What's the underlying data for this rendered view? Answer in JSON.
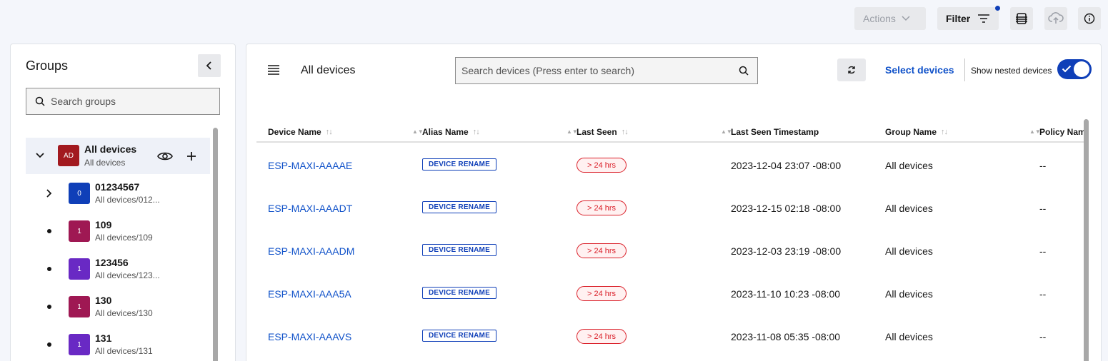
{
  "topbar": {
    "actions_label": "Actions",
    "filter_label": "Filter"
  },
  "groups": {
    "title": "Groups",
    "search_placeholder": "Search groups",
    "items": [
      {
        "initials": "AD",
        "name": "All devices",
        "path": "All devices",
        "color": "#a2191f"
      },
      {
        "initials": "0",
        "name": "01234567",
        "path": "All devices/012...",
        "color": "#0f3fb8"
      },
      {
        "initials": "1",
        "name": "109",
        "path": "All devices/109",
        "color": "#9f1853"
      },
      {
        "initials": "1",
        "name": "123456",
        "path": "All devices/123...",
        "color": "#6929c4"
      },
      {
        "initials": "1",
        "name": "130",
        "path": "All devices/130",
        "color": "#9f1853"
      },
      {
        "initials": "1",
        "name": "131",
        "path": "All devices/131",
        "color": "#6929c4"
      }
    ]
  },
  "main": {
    "title": "All devices",
    "search_placeholder": "Search devices (Press enter to search)",
    "select_devices_label": "Select devices",
    "nested_label": "Show nested devices",
    "nested_on": true,
    "columns": [
      "Device Name",
      "Alias Name",
      "Last Seen",
      "Last Seen Timestamp",
      "Group Name",
      "Policy Nam"
    ],
    "rows": [
      {
        "device": "ESP-MAXI-AAAAE",
        "alias": "DEVICE RENAME",
        "last_seen": "> 24 hrs",
        "timestamp": "2023-12-04 23:07 -08:00",
        "group": "All devices",
        "policy": "--"
      },
      {
        "device": "ESP-MAXI-AAADT",
        "alias": "DEVICE RENAME",
        "last_seen": "> 24 hrs",
        "timestamp": "2023-12-15 02:18 -08:00",
        "group": "All devices",
        "policy": "--"
      },
      {
        "device": "ESP-MAXI-AAADM",
        "alias": "DEVICE RENAME",
        "last_seen": "> 24 hrs",
        "timestamp": "2023-12-03 23:19 -08:00",
        "group": "All devices",
        "policy": "--"
      },
      {
        "device": "ESP-MAXI-AAA5A",
        "alias": "DEVICE RENAME",
        "last_seen": "> 24 hrs",
        "timestamp": "2023-11-10 10:23 -08:00",
        "group": "All devices",
        "policy": "--"
      },
      {
        "device": "ESP-MAXI-AAAVS",
        "alias": "DEVICE RENAME",
        "last_seen": "> 24 hrs",
        "timestamp": "2023-11-08 05:35 -08:00",
        "group": "All devices",
        "policy": "--"
      }
    ]
  },
  "colors": {
    "accent": "#0f3fb8",
    "link": "#0f51c9",
    "danger": "#da1e28"
  }
}
